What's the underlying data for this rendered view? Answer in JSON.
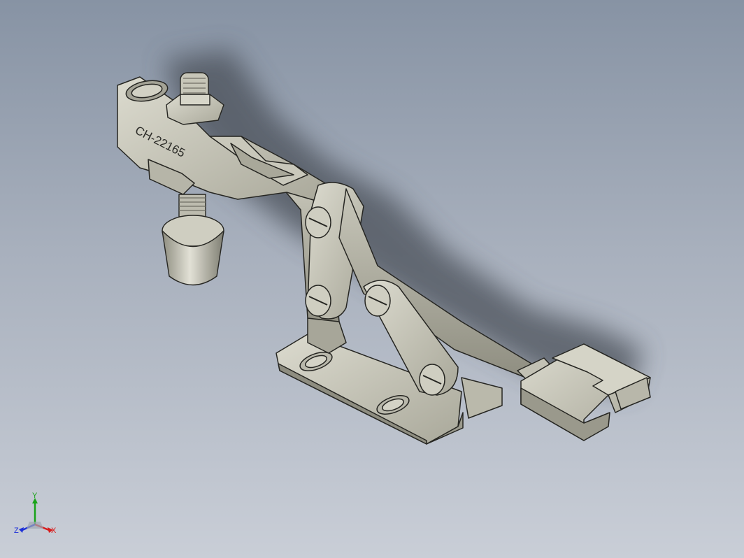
{
  "part": {
    "engraving": "CH-22165"
  },
  "triad": {
    "x_label": "X",
    "y_label": "Y",
    "z_label": "Z",
    "x_color": "#d81c1c",
    "y_color": "#19a319",
    "z_color": "#1c2fd8"
  },
  "colors": {
    "background_top": "#8793a4",
    "background_bottom": "#c9ced7",
    "metal_light": "#d6d5c8",
    "metal_mid": "#b4b3a5",
    "metal_dark": "#8e8d80",
    "edge": "#262622",
    "shadow": "#4a4f58"
  }
}
